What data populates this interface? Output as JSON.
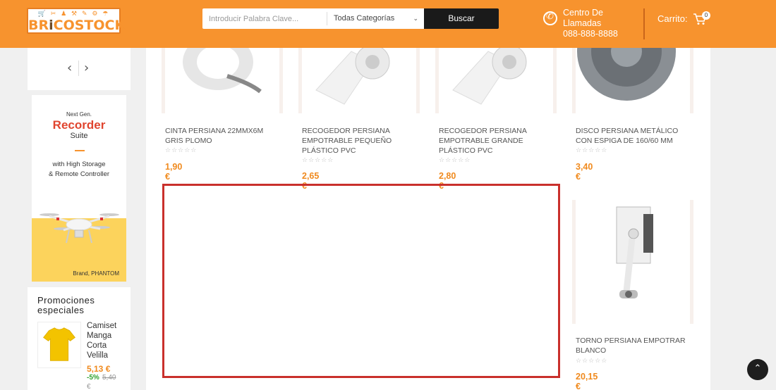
{
  "header": {
    "logo_icons": "🛒 ✂ ♟ ⚒ ✎ ⚙ ☂",
    "logo_text_pre": "BR",
    "logo_text_i": "i",
    "logo_text_post": "COSTOCK",
    "search_placeholder": "Introducir Palabra Clave...",
    "category_select": "Todas Categorías",
    "search_button": "Buscar",
    "callcenter_line1": "Centro De",
    "callcenter_line2": "Llamadas",
    "callcenter_phone": "088-888-8888",
    "cart_label": "Carrito:",
    "cart_count": "0"
  },
  "sidebar": {
    "prev_arrow": "‹",
    "next_arrow": "›",
    "banner": {
      "line1": "Next Gen.",
      "line2": "Recorder",
      "line3": "Suite",
      "line4": "with High Storage",
      "line5": "& Remote Controller",
      "brand": "Brand, PHANTOM"
    },
    "promo": {
      "title": "Promociones especiales",
      "product_name": "Camiset Manga Corta Velilla",
      "price": "5,13 €",
      "discount": "-5%",
      "old_price": "5,40",
      "currency_tail": "€"
    }
  },
  "products": [
    {
      "name": "CINTA PERSIANA 22MMX6M GRIS PLOMO",
      "stars": "☆☆☆☆☆",
      "price": "1,90 €"
    },
    {
      "name": "RECOGEDOR PERSIANA EMPOTRABLE PEQUEÑO PLÁSTICO PVC",
      "stars": "☆☆☆☆☆",
      "price": "2,65 €"
    },
    {
      "name": "RECOGEDOR PERSIANA EMPOTRABLE GRANDE PLÁSTICO PVC",
      "stars": "☆☆☆☆☆",
      "price": "2,80 €"
    },
    {
      "name": "DISCO PERSIANA METÁLICO CON ESPIGA DE 160/60 MM",
      "stars": "☆☆☆☆☆",
      "price": "3,40 €"
    },
    {
      "name": "TORNO PERSIANA EMPOTRAR BLANCO",
      "stars": "☆☆☆☆☆",
      "price": "20,15 €"
    }
  ],
  "scroll_top": "⌃"
}
